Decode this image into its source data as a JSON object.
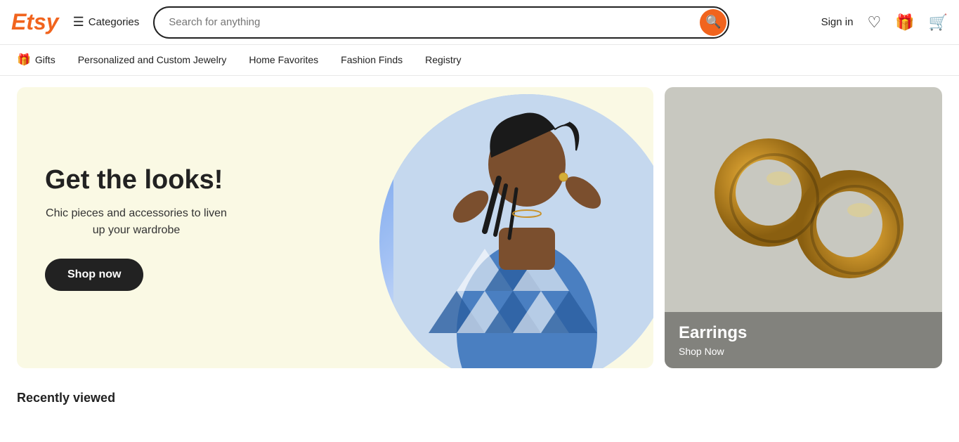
{
  "header": {
    "logo": "Etsy",
    "categories_label": "Categories",
    "search_placeholder": "Search for anything",
    "sign_in_label": "Sign in"
  },
  "nav": {
    "items": [
      {
        "id": "gifts",
        "label": "Gifts",
        "has_icon": true
      },
      {
        "id": "jewelry",
        "label": "Personalized and Custom Jewelry"
      },
      {
        "id": "home",
        "label": "Home Favorites"
      },
      {
        "id": "fashion",
        "label": "Fashion Finds"
      },
      {
        "id": "registry",
        "label": "Registry"
      }
    ]
  },
  "hero": {
    "title": "Get the looks!",
    "subtitle": "Chic pieces and accessories to liven up your wardrobe",
    "shop_now": "Shop now"
  },
  "earrings_card": {
    "title": "Earrings",
    "shop_now": "Shop Now"
  },
  "recently_viewed": {
    "title": "Recently viewed"
  },
  "icons": {
    "search": "🔍",
    "hamburger": "☰",
    "heart": "♡",
    "gift": "🎁",
    "cart": "🛒"
  }
}
